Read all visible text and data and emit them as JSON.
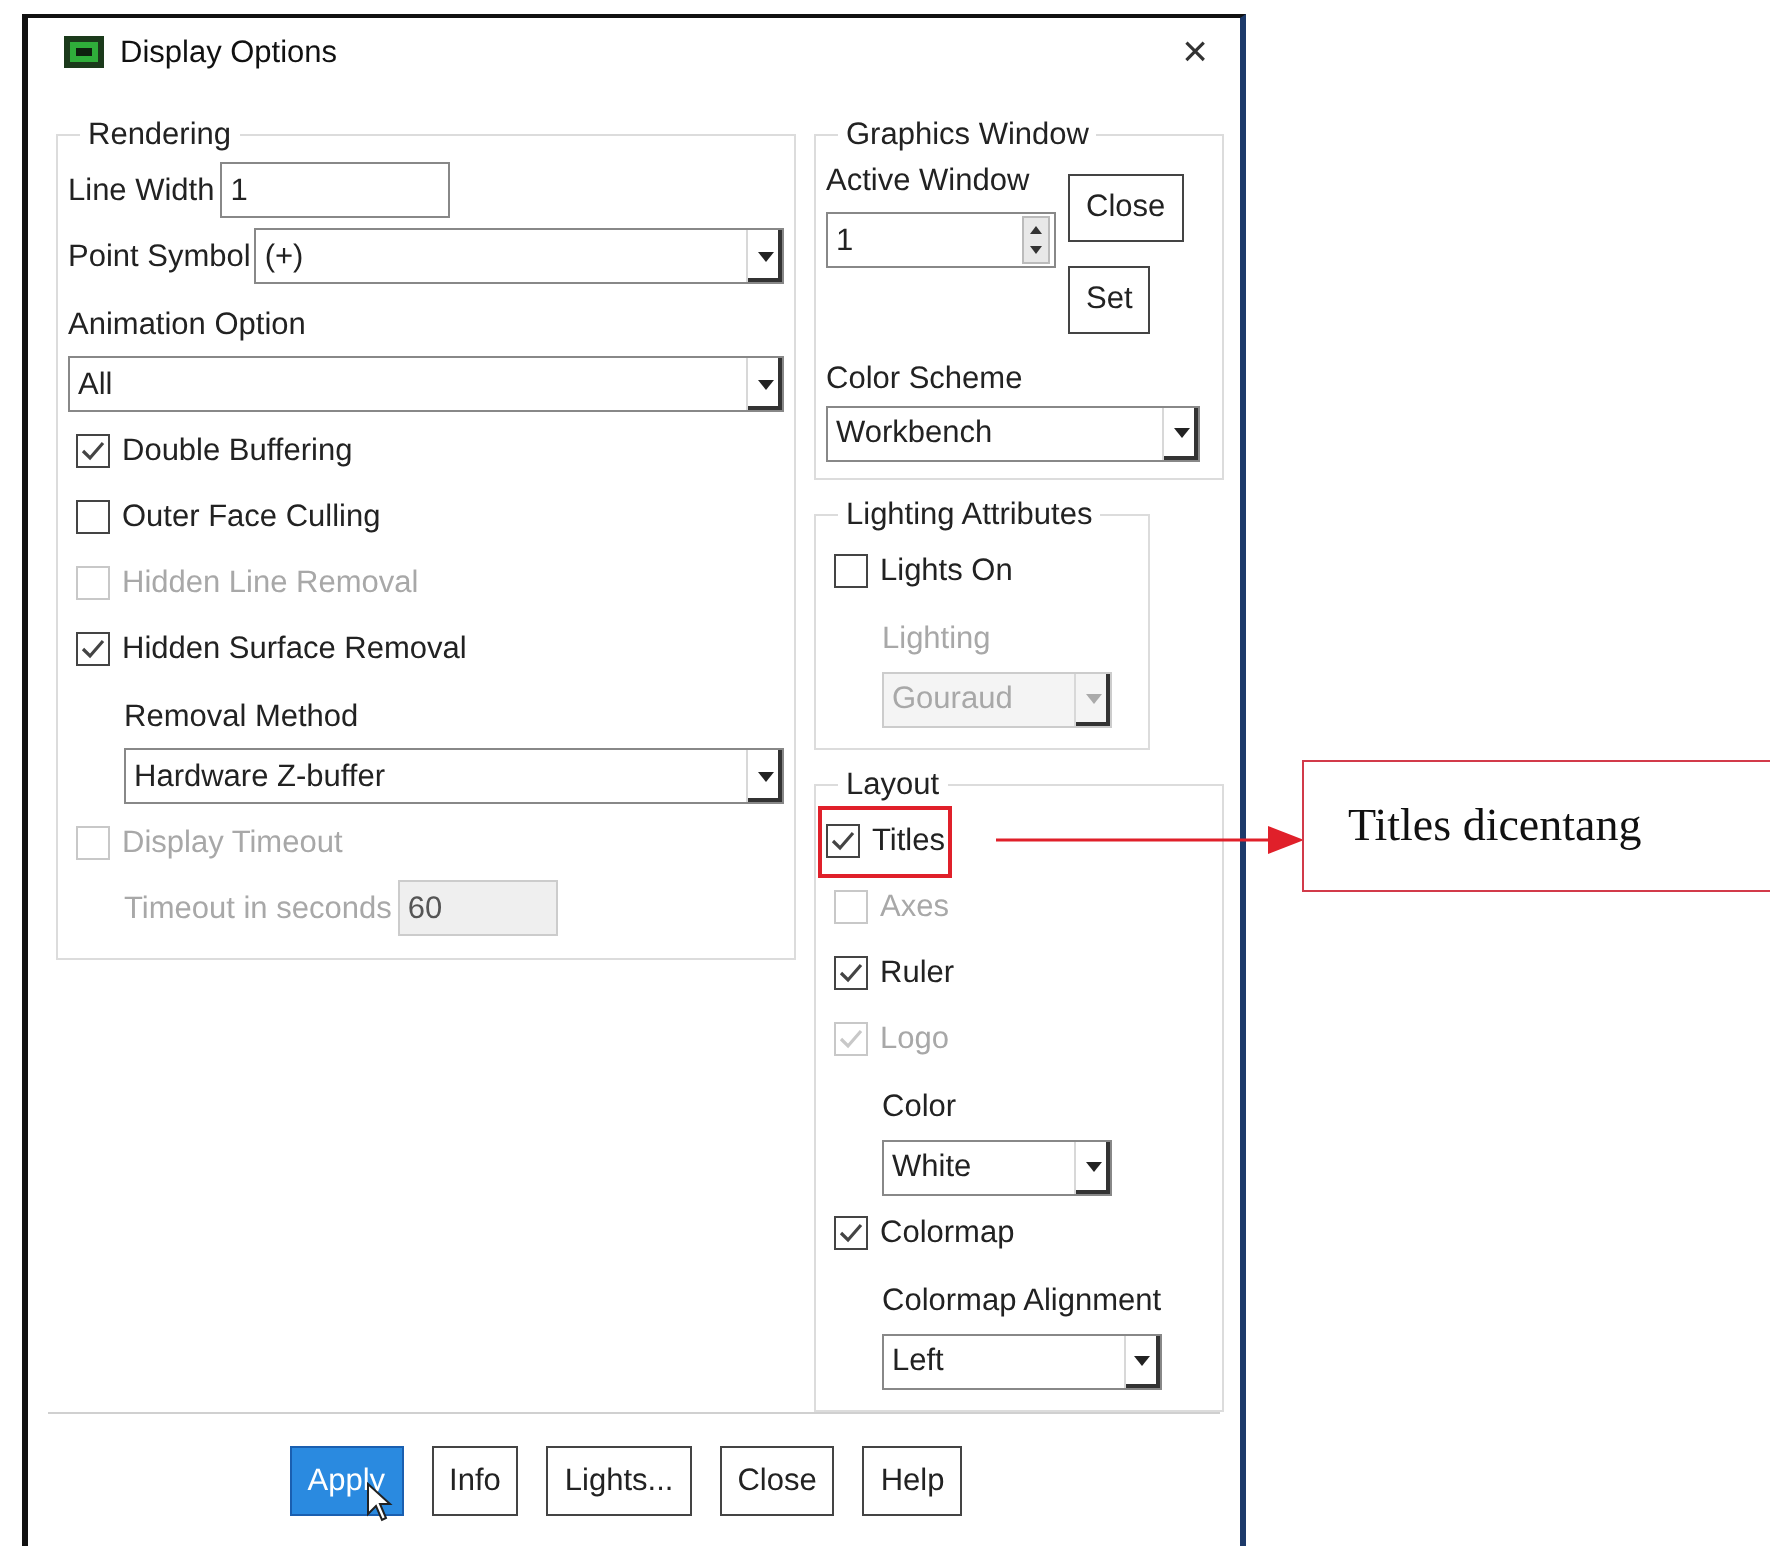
{
  "window": {
    "title": "Display Options",
    "close": "×"
  },
  "rendering": {
    "title": "Rendering",
    "items": [
      {
        "kind": "field",
        "label": "Line Width",
        "value": "1"
      },
      {
        "kind": "select",
        "label": "Point Symbol",
        "value": "(+)"
      },
      {
        "kind": "label",
        "label": "Animation Option"
      },
      {
        "kind": "select",
        "value": "All"
      },
      {
        "kind": "checkbox",
        "label": "Double Buffering",
        "checked": true,
        "disabled": false
      },
      {
        "kind": "checkbox",
        "label": "Outer Face Culling",
        "checked": false,
        "disabled": false
      },
      {
        "kind": "checkbox",
        "label": "Hidden Line Removal",
        "checked": false,
        "disabled": true
      },
      {
        "kind": "checkbox",
        "label": "Hidden Surface Removal",
        "checked": true,
        "disabled": false,
        "children": [
          {
            "kind": "label",
            "label": "Removal Method"
          },
          {
            "kind": "select",
            "value": "Hardware Z-buffer"
          }
        ]
      },
      {
        "kind": "checkbox",
        "label": "Display Timeout",
        "checked": false,
        "disabled": true,
        "children": [
          {
            "kind": "field",
            "label": "Timeout in seconds",
            "value": "60",
            "disabled": true
          }
        ]
      }
    ]
  },
  "graphics_window": {
    "title": "Graphics Window",
    "active_window": {
      "label": "Active Window",
      "value": "1"
    },
    "buttons": [
      "Close",
      "Set"
    ],
    "color_scheme": {
      "label": "Color Scheme",
      "value": "Workbench"
    }
  },
  "lighting_attributes": {
    "title": "Lighting Attributes",
    "items": [
      {
        "kind": "checkbox",
        "label": "Lights On",
        "checked": false,
        "disabled": false,
        "children": [
          {
            "kind": "label",
            "label": "Lighting",
            "disabled": true
          },
          {
            "kind": "select",
            "value": "Gouraud",
            "disabled": true
          }
        ]
      }
    ]
  },
  "layout": {
    "title": "Layout",
    "items": [
      {
        "kind": "checkbox",
        "label": "Titles",
        "checked": true,
        "disabled": false,
        "highlighted": true
      },
      {
        "kind": "checkbox",
        "label": "Axes",
        "checked": false,
        "disabled": true,
        "highlighted": false
      },
      {
        "kind": "checkbox",
        "label": "Ruler",
        "checked": true,
        "disabled": false,
        "highlighted": false
      },
      {
        "kind": "checkbox",
        "label": "Logo",
        "checked": true,
        "disabled": true,
        "highlighted": false,
        "children": [
          {
            "kind": "label",
            "label": "Color"
          },
          {
            "kind": "select",
            "value": "White"
          }
        ]
      },
      {
        "kind": "checkbox",
        "label": "Colormap",
        "checked": true,
        "disabled": false,
        "highlighted": false,
        "children": [
          {
            "kind": "label",
            "label": "Colormap Alignment"
          },
          {
            "kind": "select",
            "value": "Left"
          }
        ]
      }
    ]
  },
  "buttons": [
    {
      "label": "Apply",
      "selected": true
    },
    {
      "label": "Info",
      "selected": false
    },
    {
      "label": "Lights...",
      "selected": false
    },
    {
      "label": "Close",
      "selected": false
    },
    {
      "label": "Help",
      "selected": false
    }
  ],
  "annotation": {
    "text": "Titles dicentang"
  }
}
